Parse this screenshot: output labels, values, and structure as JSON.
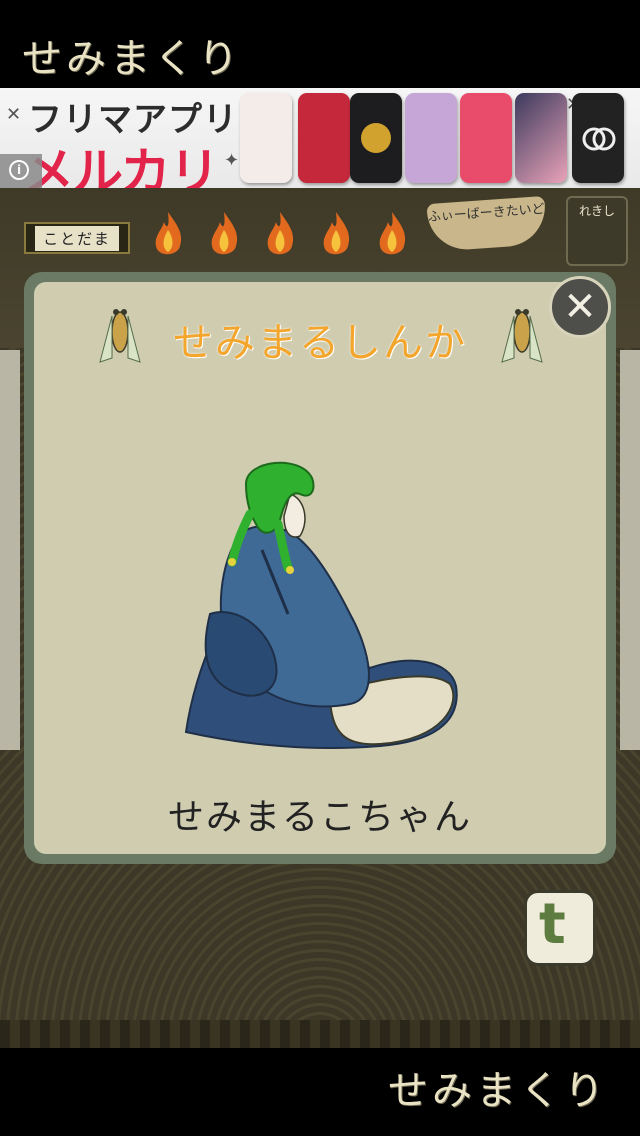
{
  "header": {
    "brand": "せみまくり"
  },
  "footer": {
    "brand": "せみまくり"
  },
  "ad": {
    "line1": "フリマアプリ",
    "line2": "メルカリ",
    "info_icon": "info-icon"
  },
  "hud": {
    "kotodama_label": "ことだま",
    "fever_label": "ふぃーばーきたいど",
    "history_label": "れきし"
  },
  "modal": {
    "title": "せみまるしんか",
    "character_name": "せみまるこちゃん",
    "close_icon": "close-icon"
  },
  "share": {
    "icon": "twitter-icon",
    "glyph": "t"
  },
  "colors": {
    "title": "#f3a52c",
    "modal_bg": "#cfccb0",
    "modal_border": "#6b7a64",
    "ad_red": "#e2244a"
  }
}
